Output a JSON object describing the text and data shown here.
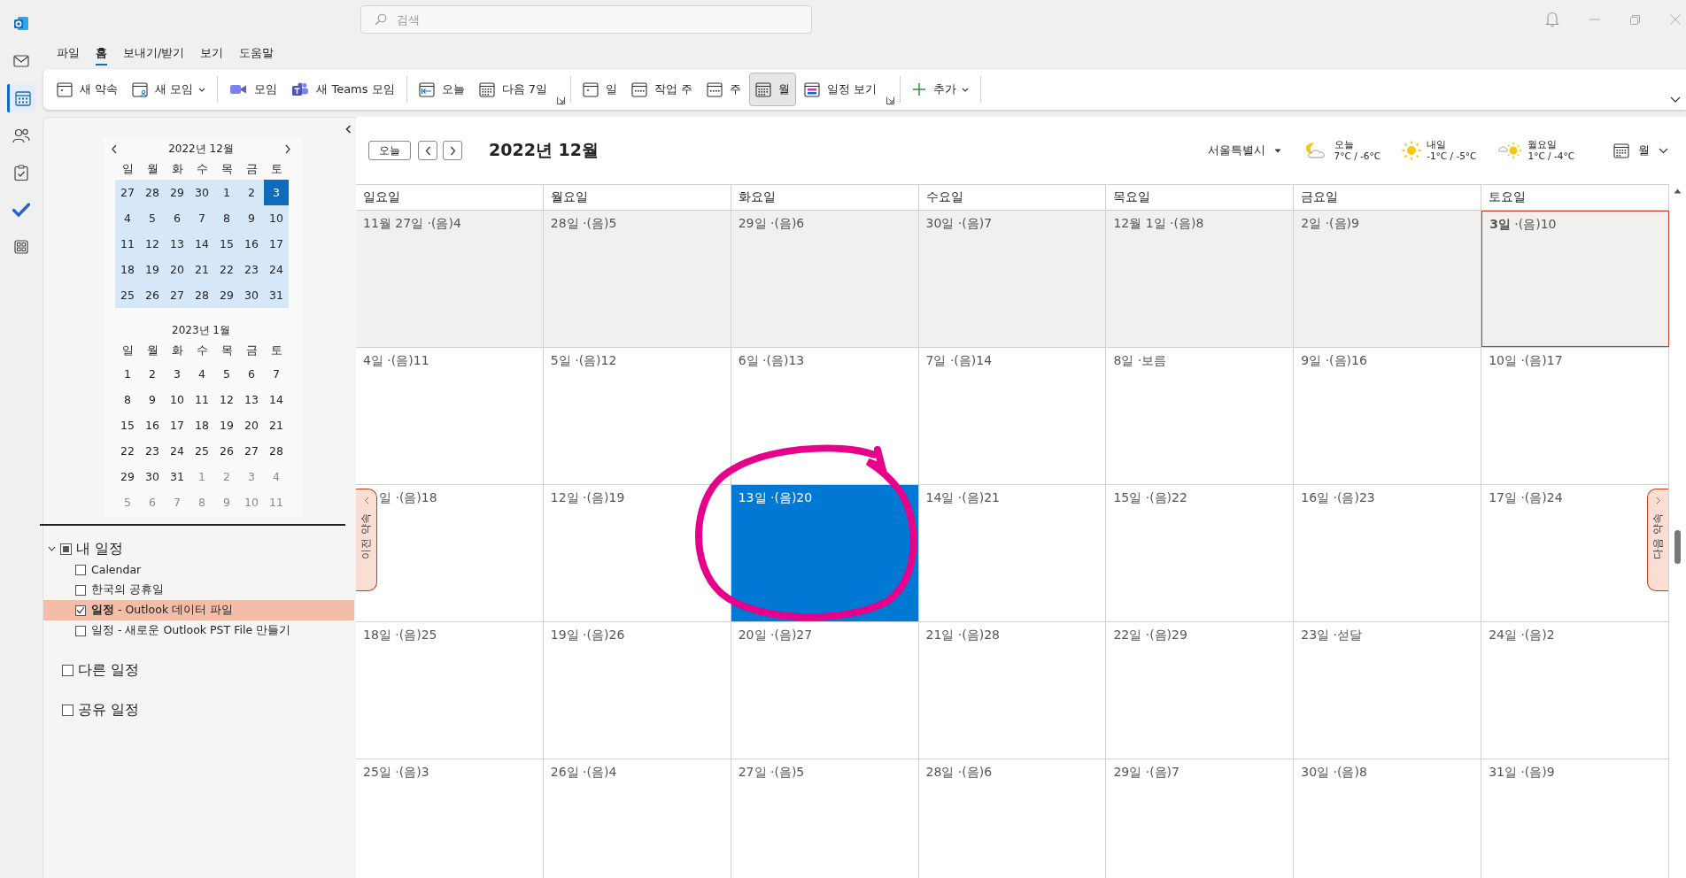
{
  "rail": [
    {
      "kind": "logo",
      "selected": false
    },
    {
      "kind": "mail",
      "selected": false
    },
    {
      "kind": "calendar",
      "selected": true
    },
    {
      "kind": "people",
      "selected": false
    },
    {
      "kind": "tasks",
      "selected": false
    },
    {
      "kind": "todo",
      "selected": false
    },
    {
      "kind": "apps",
      "selected": false
    }
  ],
  "search": {
    "placeholder": "검색"
  },
  "menu": [
    {
      "label": "파일",
      "selected": false
    },
    {
      "label": "홈",
      "selected": true
    },
    {
      "label": "보내기/받기",
      "selected": false
    },
    {
      "label": "보기",
      "selected": false
    },
    {
      "label": "도움말",
      "selected": false
    }
  ],
  "ribbon": {
    "groups": [
      {
        "launcher": false,
        "buttons": [
          {
            "label": "새 약속",
            "kind": "calendar",
            "dropdown": false,
            "selected": false
          },
          {
            "label": "새 모임",
            "kind": "people",
            "dropdown": true,
            "selected": false
          }
        ]
      },
      {
        "launcher": false,
        "buttons": [
          {
            "label": "모임",
            "kind": "video",
            "dropdown": false,
            "selected": false
          },
          {
            "label": "새 Teams 모임",
            "kind": "teams",
            "dropdown": false,
            "selected": false
          }
        ]
      },
      {
        "launcher": true,
        "buttons": [
          {
            "label": "오늘",
            "kind": "today",
            "dropdown": false,
            "selected": false
          },
          {
            "label": "다음 7일",
            "kind": "grid",
            "dropdown": false,
            "selected": false
          }
        ]
      },
      {
        "launcher": true,
        "buttons": [
          {
            "label": "일",
            "kind": "day",
            "dropdown": false,
            "selected": false
          },
          {
            "label": "작업 주",
            "kind": "week",
            "dropdown": false,
            "selected": false
          },
          {
            "label": "주",
            "kind": "week",
            "dropdown": false,
            "selected": false
          },
          {
            "label": "월",
            "kind": "grid",
            "dropdown": false,
            "selected": true
          },
          {
            "label": "일정 보기",
            "kind": "schedule",
            "dropdown": false,
            "selected": false
          }
        ]
      },
      {
        "launcher": false,
        "buttons": [
          {
            "label": "추가",
            "kind": "plus",
            "dropdown": true,
            "selected": false
          }
        ]
      }
    ]
  },
  "mini_calendars": [
    {
      "title": "2022년 12월",
      "highlighted": true,
      "weekdays": [
        "일",
        "월",
        "화",
        "수",
        "목",
        "금",
        "토"
      ],
      "days": [
        {
          "d": "27",
          "selected": false,
          "dim": false
        },
        {
          "d": "28",
          "selected": false,
          "dim": false
        },
        {
          "d": "29",
          "selected": false,
          "dim": false
        },
        {
          "d": "30",
          "selected": false,
          "dim": false
        },
        {
          "d": "1",
          "selected": false,
          "dim": false
        },
        {
          "d": "2",
          "selected": false,
          "dim": false
        },
        {
          "d": "3",
          "selected": true,
          "dim": false
        },
        {
          "d": "4",
          "selected": false,
          "dim": false
        },
        {
          "d": "5",
          "selected": false,
          "dim": false
        },
        {
          "d": "6",
          "selected": false,
          "dim": false
        },
        {
          "d": "7",
          "selected": false,
          "dim": false
        },
        {
          "d": "8",
          "selected": false,
          "dim": false
        },
        {
          "d": "9",
          "selected": false,
          "dim": false
        },
        {
          "d": "10",
          "selected": false,
          "dim": false
        },
        {
          "d": "11",
          "selected": false,
          "dim": false
        },
        {
          "d": "12",
          "selected": false,
          "dim": false
        },
        {
          "d": "13",
          "selected": false,
          "dim": false
        },
        {
          "d": "14",
          "selected": false,
          "dim": false
        },
        {
          "d": "15",
          "selected": false,
          "dim": false
        },
        {
          "d": "16",
          "selected": false,
          "dim": false
        },
        {
          "d": "17",
          "selected": false,
          "dim": false
        },
        {
          "d": "18",
          "selected": false,
          "dim": false
        },
        {
          "d": "19",
          "selected": false,
          "dim": false
        },
        {
          "d": "20",
          "selected": false,
          "dim": false
        },
        {
          "d": "21",
          "selected": false,
          "dim": false
        },
        {
          "d": "22",
          "selected": false,
          "dim": false
        },
        {
          "d": "23",
          "selected": false,
          "dim": false
        },
        {
          "d": "24",
          "selected": false,
          "dim": false
        },
        {
          "d": "25",
          "selected": false,
          "dim": false
        },
        {
          "d": "26",
          "selected": false,
          "dim": false
        },
        {
          "d": "27",
          "selected": false,
          "dim": false
        },
        {
          "d": "28",
          "selected": false,
          "dim": false
        },
        {
          "d": "29",
          "selected": false,
          "dim": false
        },
        {
          "d": "30",
          "selected": false,
          "dim": false
        },
        {
          "d": "31",
          "selected": false,
          "dim": false
        }
      ]
    },
    {
      "title": "2023년 1월",
      "highlighted": false,
      "weekdays": [
        "일",
        "월",
        "화",
        "수",
        "목",
        "금",
        "토"
      ],
      "days": [
        {
          "d": "1",
          "selected": false,
          "dim": false
        },
        {
          "d": "2",
          "selected": false,
          "dim": false
        },
        {
          "d": "3",
          "selected": false,
          "dim": false
        },
        {
          "d": "4",
          "selected": false,
          "dim": false
        },
        {
          "d": "5",
          "selected": false,
          "dim": false
        },
        {
          "d": "6",
          "selected": false,
          "dim": false
        },
        {
          "d": "7",
          "selected": false,
          "dim": false
        },
        {
          "d": "8",
          "selected": false,
          "dim": false
        },
        {
          "d": "9",
          "selected": false,
          "dim": false
        },
        {
          "d": "10",
          "selected": false,
          "dim": false
        },
        {
          "d": "11",
          "selected": false,
          "dim": false
        },
        {
          "d": "12",
          "selected": false,
          "dim": false
        },
        {
          "d": "13",
          "selected": false,
          "dim": false
        },
        {
          "d": "14",
          "selected": false,
          "dim": false
        },
        {
          "d": "15",
          "selected": false,
          "dim": false
        },
        {
          "d": "16",
          "selected": false,
          "dim": false
        },
        {
          "d": "17",
          "selected": false,
          "dim": false
        },
        {
          "d": "18",
          "selected": false,
          "dim": false
        },
        {
          "d": "19",
          "selected": false,
          "dim": false
        },
        {
          "d": "20",
          "selected": false,
          "dim": false
        },
        {
          "d": "21",
          "selected": false,
          "dim": false
        },
        {
          "d": "22",
          "selected": false,
          "dim": false
        },
        {
          "d": "23",
          "selected": false,
          "dim": false
        },
        {
          "d": "24",
          "selected": false,
          "dim": false
        },
        {
          "d": "25",
          "selected": false,
          "dim": false
        },
        {
          "d": "26",
          "selected": false,
          "dim": false
        },
        {
          "d": "27",
          "selected": false,
          "dim": false
        },
        {
          "d": "28",
          "selected": false,
          "dim": false
        },
        {
          "d": "29",
          "selected": false,
          "dim": false
        },
        {
          "d": "30",
          "selected": false,
          "dim": false
        },
        {
          "d": "31",
          "selected": false,
          "dim": false
        },
        {
          "d": "1",
          "selected": false,
          "dim": true
        },
        {
          "d": "2",
          "selected": false,
          "dim": true
        },
        {
          "d": "3",
          "selected": false,
          "dim": true
        },
        {
          "d": "4",
          "selected": false,
          "dim": true
        },
        {
          "d": "5",
          "selected": false,
          "dim": true
        },
        {
          "d": "6",
          "selected": false,
          "dim": true
        },
        {
          "d": "7",
          "selected": false,
          "dim": true
        },
        {
          "d": "8",
          "selected": false,
          "dim": true
        },
        {
          "d": "9",
          "selected": false,
          "dim": true
        },
        {
          "d": "10",
          "selected": false,
          "dim": true
        },
        {
          "d": "11",
          "selected": false,
          "dim": true
        }
      ]
    }
  ],
  "folders": [
    {
      "label": "내 일정",
      "expanded": true,
      "checked": true,
      "children": [
        {
          "label": "Calendar",
          "checked": false,
          "selected": false
        },
        {
          "label": "한국의 공휴일",
          "checked": false,
          "selected": false
        },
        {
          "label": "**일정** - Outlook 데이터 파일",
          "checked": true,
          "selected": true
        },
        {
          "label": "일정 - 새로운 Outlook PST File 만들기",
          "checked": false,
          "selected": false
        }
      ]
    },
    {
      "label": "다른 일정",
      "checked": false
    },
    {
      "label": "공유 일정",
      "checked": false
    }
  ],
  "calendar": {
    "today_button": "오늘",
    "title": "2022년 12월",
    "location": "서울특별시",
    "weather": [
      {
        "day": "오늘",
        "temp": "7°C / -6°C",
        "kind": "night_cloud"
      },
      {
        "day": "내일",
        "temp": "-1°C / -5°C",
        "kind": "sun"
      },
      {
        "day": "월요일",
        "temp": "1°C / -4°C",
        "kind": "cloud_sun"
      }
    ],
    "view": "월",
    "weekdays": [
      "일요일",
      "월요일",
      "화요일",
      "수요일",
      "목요일",
      "금요일",
      "토요일"
    ],
    "prev_tab": "이전 약속",
    "next_tab": "다음 약속",
    "weeks": [
      [
        {
          "label": "11월 27일 ·(음)4",
          "past": true,
          "today": false,
          "selected": false
        },
        {
          "label": "28일 ·(음)5",
          "past": true,
          "today": false,
          "selected": false
        },
        {
          "label": "29일 ·(음)6",
          "past": true,
          "today": false,
          "selected": false
        },
        {
          "label": "30일 ·(음)7",
          "past": true,
          "today": false,
          "selected": false
        },
        {
          "label": "12월 1일 ·(음)8",
          "past": true,
          "today": false,
          "selected": false
        },
        {
          "label": "2일 ·(음)9",
          "past": true,
          "today": false,
          "selected": false
        },
        {
          "label": "**3일** ·(음)10",
          "past": true,
          "today": true,
          "selected": false
        }
      ],
      [
        {
          "label": "4일 ·(음)11",
          "past": false,
          "today": false,
          "selected": false
        },
        {
          "label": "5일 ·(음)12",
          "past": false,
          "today": false,
          "selected": false
        },
        {
          "label": "6일 ·(음)13",
          "past": false,
          "today": false,
          "selected": false
        },
        {
          "label": "7일 ·(음)14",
          "past": false,
          "today": false,
          "selected": false
        },
        {
          "label": "8일 ·보름",
          "past": false,
          "today": false,
          "selected": false
        },
        {
          "label": "9일 ·(음)16",
          "past": false,
          "today": false,
          "selected": false
        },
        {
          "label": "10일 ·(음)17",
          "past": false,
          "today": false,
          "selected": false
        }
      ],
      [
        {
          "label": "일 ·(음)18",
          "past": false,
          "today": false,
          "selected": false
        },
        {
          "label": "12일 ·(음)19",
          "past": false,
          "today": false,
          "selected": false
        },
        {
          "label": "13일 ·(음)20",
          "past": false,
          "today": false,
          "selected": true
        },
        {
          "label": "14일 ·(음)21",
          "past": false,
          "today": false,
          "selected": false
        },
        {
          "label": "15일 ·(음)22",
          "past": false,
          "today": false,
          "selected": false
        },
        {
          "label": "16일 ·(음)23",
          "past": false,
          "today": false,
          "selected": false
        },
        {
          "label": "17일 ·(음)24",
          "past": false,
          "today": false,
          "selected": false
        }
      ],
      [
        {
          "label": "18일 ·(음)25",
          "past": false,
          "today": false,
          "selected": false
        },
        {
          "label": "19일 ·(음)26",
          "past": false,
          "today": false,
          "selected": false
        },
        {
          "label": "20일 ·(음)27",
          "past": false,
          "today": false,
          "selected": false
        },
        {
          "label": "21일 ·(음)28",
          "past": false,
          "today": false,
          "selected": false
        },
        {
          "label": "22일 ·(음)29",
          "past": false,
          "today": false,
          "selected": false
        },
        {
          "label": "23일 ·섣달",
          "past": false,
          "today": false,
          "selected": false
        },
        {
          "label": "24일 ·(음)2",
          "past": false,
          "today": false,
          "selected": false
        }
      ],
      [
        {
          "label": "25일 ·(음)3",
          "past": false,
          "today": false,
          "selected": false
        },
        {
          "label": "26일 ·(음)4",
          "past": false,
          "today": false,
          "selected": false
        },
        {
          "label": "27일 ·(음)5",
          "past": false,
          "today": false,
          "selected": false
        },
        {
          "label": "28일 ·(음)6",
          "past": false,
          "today": false,
          "selected": false
        },
        {
          "label": "29일 ·(음)7",
          "past": false,
          "today": false,
          "selected": false
        },
        {
          "label": "30일 ·(음)8",
          "past": false,
          "today": false,
          "selected": false
        },
        {
          "label": "31일 ·(음)9",
          "past": false,
          "today": false,
          "selected": false
        }
      ]
    ]
  },
  "annotation": {
    "kind": "circle"
  }
}
